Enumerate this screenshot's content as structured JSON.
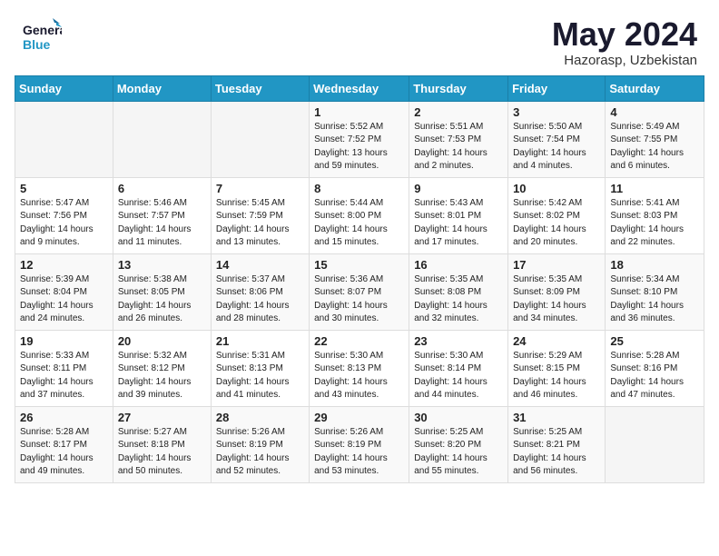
{
  "header": {
    "logo_general": "General",
    "logo_blue": "Blue",
    "month": "May 2024",
    "location": "Hazorasp, Uzbekistan"
  },
  "days_of_week": [
    "Sunday",
    "Monday",
    "Tuesday",
    "Wednesday",
    "Thursday",
    "Friday",
    "Saturday"
  ],
  "weeks": [
    [
      {
        "day": "",
        "info": ""
      },
      {
        "day": "",
        "info": ""
      },
      {
        "day": "",
        "info": ""
      },
      {
        "day": "1",
        "info": "Sunrise: 5:52 AM\nSunset: 7:52 PM\nDaylight: 13 hours\nand 59 minutes."
      },
      {
        "day": "2",
        "info": "Sunrise: 5:51 AM\nSunset: 7:53 PM\nDaylight: 14 hours\nand 2 minutes."
      },
      {
        "day": "3",
        "info": "Sunrise: 5:50 AM\nSunset: 7:54 PM\nDaylight: 14 hours\nand 4 minutes."
      },
      {
        "day": "4",
        "info": "Sunrise: 5:49 AM\nSunset: 7:55 PM\nDaylight: 14 hours\nand 6 minutes."
      }
    ],
    [
      {
        "day": "5",
        "info": "Sunrise: 5:47 AM\nSunset: 7:56 PM\nDaylight: 14 hours\nand 9 minutes."
      },
      {
        "day": "6",
        "info": "Sunrise: 5:46 AM\nSunset: 7:57 PM\nDaylight: 14 hours\nand 11 minutes."
      },
      {
        "day": "7",
        "info": "Sunrise: 5:45 AM\nSunset: 7:59 PM\nDaylight: 14 hours\nand 13 minutes."
      },
      {
        "day": "8",
        "info": "Sunrise: 5:44 AM\nSunset: 8:00 PM\nDaylight: 14 hours\nand 15 minutes."
      },
      {
        "day": "9",
        "info": "Sunrise: 5:43 AM\nSunset: 8:01 PM\nDaylight: 14 hours\nand 17 minutes."
      },
      {
        "day": "10",
        "info": "Sunrise: 5:42 AM\nSunset: 8:02 PM\nDaylight: 14 hours\nand 20 minutes."
      },
      {
        "day": "11",
        "info": "Sunrise: 5:41 AM\nSunset: 8:03 PM\nDaylight: 14 hours\nand 22 minutes."
      }
    ],
    [
      {
        "day": "12",
        "info": "Sunrise: 5:39 AM\nSunset: 8:04 PM\nDaylight: 14 hours\nand 24 minutes."
      },
      {
        "day": "13",
        "info": "Sunrise: 5:38 AM\nSunset: 8:05 PM\nDaylight: 14 hours\nand 26 minutes."
      },
      {
        "day": "14",
        "info": "Sunrise: 5:37 AM\nSunset: 8:06 PM\nDaylight: 14 hours\nand 28 minutes."
      },
      {
        "day": "15",
        "info": "Sunrise: 5:36 AM\nSunset: 8:07 PM\nDaylight: 14 hours\nand 30 minutes."
      },
      {
        "day": "16",
        "info": "Sunrise: 5:35 AM\nSunset: 8:08 PM\nDaylight: 14 hours\nand 32 minutes."
      },
      {
        "day": "17",
        "info": "Sunrise: 5:35 AM\nSunset: 8:09 PM\nDaylight: 14 hours\nand 34 minutes."
      },
      {
        "day": "18",
        "info": "Sunrise: 5:34 AM\nSunset: 8:10 PM\nDaylight: 14 hours\nand 36 minutes."
      }
    ],
    [
      {
        "day": "19",
        "info": "Sunrise: 5:33 AM\nSunset: 8:11 PM\nDaylight: 14 hours\nand 37 minutes."
      },
      {
        "day": "20",
        "info": "Sunrise: 5:32 AM\nSunset: 8:12 PM\nDaylight: 14 hours\nand 39 minutes."
      },
      {
        "day": "21",
        "info": "Sunrise: 5:31 AM\nSunset: 8:13 PM\nDaylight: 14 hours\nand 41 minutes."
      },
      {
        "day": "22",
        "info": "Sunrise: 5:30 AM\nSunset: 8:13 PM\nDaylight: 14 hours\nand 43 minutes."
      },
      {
        "day": "23",
        "info": "Sunrise: 5:30 AM\nSunset: 8:14 PM\nDaylight: 14 hours\nand 44 minutes."
      },
      {
        "day": "24",
        "info": "Sunrise: 5:29 AM\nSunset: 8:15 PM\nDaylight: 14 hours\nand 46 minutes."
      },
      {
        "day": "25",
        "info": "Sunrise: 5:28 AM\nSunset: 8:16 PM\nDaylight: 14 hours\nand 47 minutes."
      }
    ],
    [
      {
        "day": "26",
        "info": "Sunrise: 5:28 AM\nSunset: 8:17 PM\nDaylight: 14 hours\nand 49 minutes."
      },
      {
        "day": "27",
        "info": "Sunrise: 5:27 AM\nSunset: 8:18 PM\nDaylight: 14 hours\nand 50 minutes."
      },
      {
        "day": "28",
        "info": "Sunrise: 5:26 AM\nSunset: 8:19 PM\nDaylight: 14 hours\nand 52 minutes."
      },
      {
        "day": "29",
        "info": "Sunrise: 5:26 AM\nSunset: 8:19 PM\nDaylight: 14 hours\nand 53 minutes."
      },
      {
        "day": "30",
        "info": "Sunrise: 5:25 AM\nSunset: 8:20 PM\nDaylight: 14 hours\nand 55 minutes."
      },
      {
        "day": "31",
        "info": "Sunrise: 5:25 AM\nSunset: 8:21 PM\nDaylight: 14 hours\nand 56 minutes."
      },
      {
        "day": "",
        "info": ""
      }
    ]
  ]
}
